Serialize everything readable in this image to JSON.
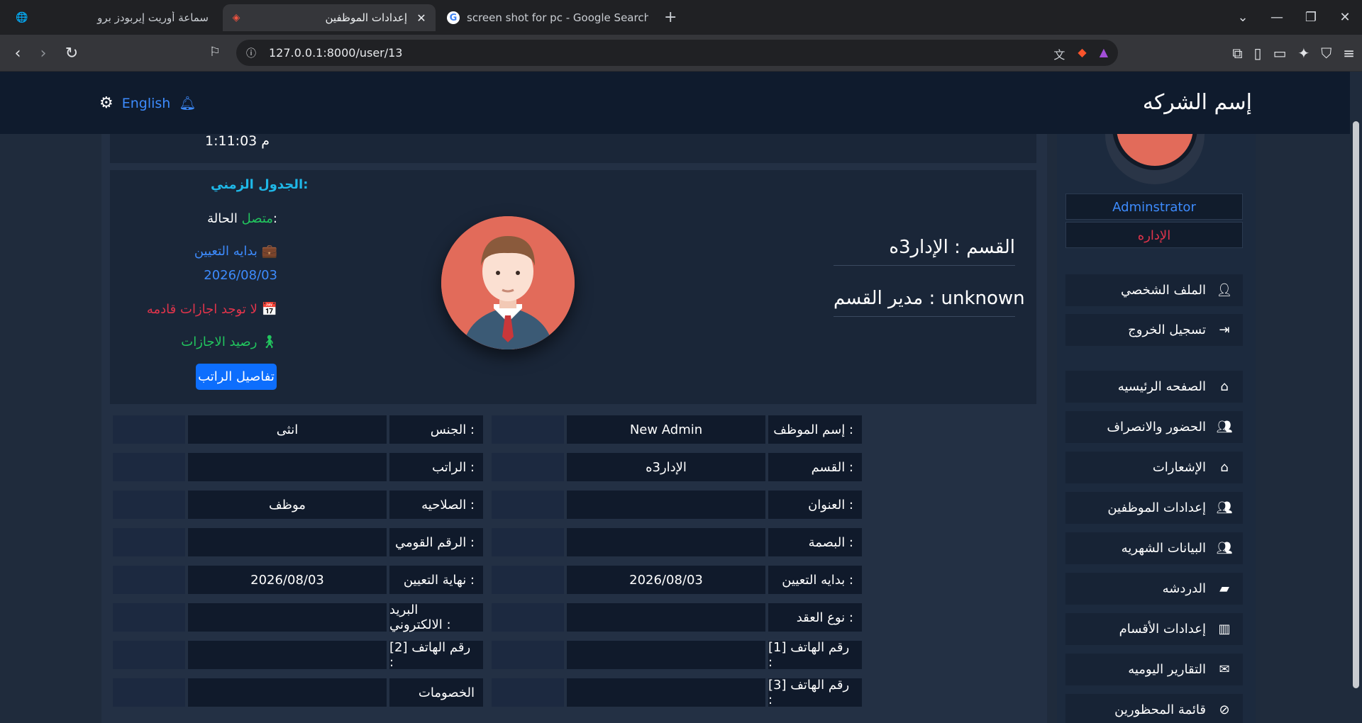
{
  "browser": {
    "tabs": [
      {
        "label": "سماعة أوريت إيربودز برو"
      },
      {
        "label": "إعدادات الموظفين"
      },
      {
        "label": "screen shot for pc - Google Search"
      }
    ],
    "url": "127.0.0.1:8000/user/13"
  },
  "header": {
    "company_name": "إسم الشركه",
    "language": "English"
  },
  "sidebar": {
    "role": "Adminstrator",
    "department": "الإداره",
    "items": [
      {
        "label": "الملف الشخصي",
        "icon": "user-edit-icon"
      },
      {
        "label": "تسجيل الخروج",
        "icon": "sign-out-icon"
      },
      {
        "label": "الصفحه الرئيسيه",
        "icon": "home-icon"
      },
      {
        "label": "الحضور والانصراف",
        "icon": "users-icon"
      },
      {
        "label": "الإشعارات",
        "icon": "home-icon"
      },
      {
        "label": "إعدادات الموظفين",
        "icon": "users-icon"
      },
      {
        "label": "البيانات الشهريه",
        "icon": "users-icon"
      },
      {
        "label": "الدردشه",
        "icon": "comment-icon"
      },
      {
        "label": "إعدادات الأقسام",
        "icon": "chart-bar-icon"
      },
      {
        "label": "التقارير اليوميه",
        "icon": "envelope-icon"
      },
      {
        "label": "قائمة المحظورين",
        "icon": "ban-icon"
      }
    ]
  },
  "top_card": {
    "time": "1:11:03 م"
  },
  "profile": {
    "schedule_title": "الجدول الزمني:",
    "status_label": "الحالة:",
    "status_value": "متصل",
    "hire_start_label": "بدايه التعيين",
    "hire_start_date": "2026/08/03",
    "no_vacations": "لا توجد اجازات قادمه",
    "vacation_balance": "رصيد الاجازات",
    "salary_button": "تفاصيل الراتب",
    "department_line": "القسم : الإدار3ه",
    "manager_line": "مدير القسم : unknown"
  },
  "details": {
    "rows": [
      {
        "right_label": "إسم الموظف :",
        "right_value": "New Admin",
        "left_label": "الجنس :",
        "left_value": "انثى"
      },
      {
        "right_label": "القسم :",
        "right_value": "الإدار3ه",
        "left_label": "الراتب :",
        "left_value": ""
      },
      {
        "right_label": "العنوان :",
        "right_value": "",
        "left_label": "الصلاحيه :",
        "left_value": "موظف"
      },
      {
        "right_label": "البصمة :",
        "right_value": "",
        "left_label": "الرقم القومي :",
        "left_value": ""
      },
      {
        "right_label": "بدايه التعيين :",
        "right_value": "2026/08/03",
        "left_label": "نهاية التعيين :",
        "left_value": "2026/08/03"
      },
      {
        "right_label": "نوع العقد :",
        "right_value": "",
        "left_label": "البريد الالكتروني :",
        "left_value": ""
      },
      {
        "right_label": "رقم الهاتف [1] :",
        "right_value": "",
        "left_label": "رقم الهاتف [2] :",
        "left_value": ""
      },
      {
        "right_label": "رقم الهاتف [3] :",
        "right_value": "",
        "left_label": "الخصومات",
        "left_value": ""
      }
    ]
  }
}
